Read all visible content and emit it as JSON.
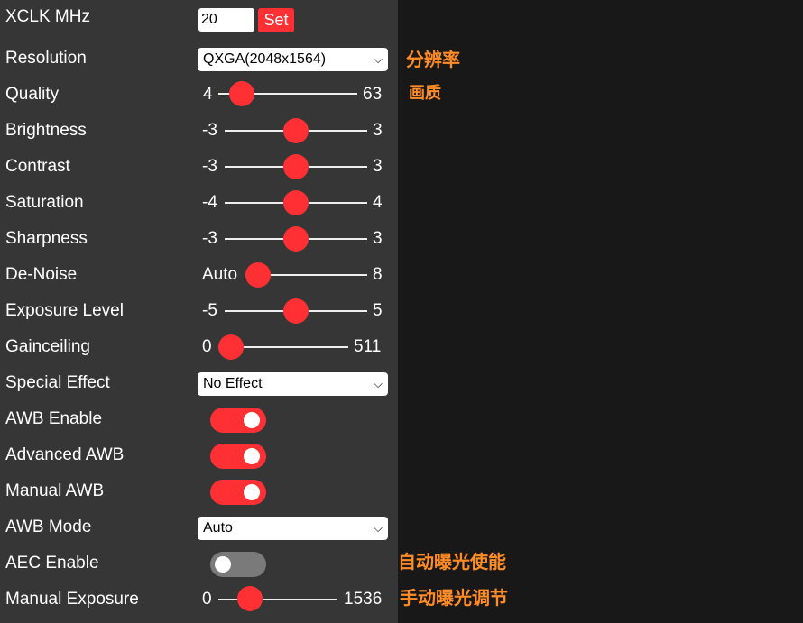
{
  "colors": {
    "panel_bg": "#363636",
    "page_bg": "#181818",
    "accent": "#ff3034",
    "toggle_off": "#7a7a7a",
    "annotation": "#ff8c26"
  },
  "xclk": {
    "label": "XCLK MHz",
    "value": "20",
    "button": "Set"
  },
  "resolution": {
    "label": "Resolution",
    "selected": "QXGA(2048x1564)",
    "note": "分辨率"
  },
  "quality": {
    "label": "Quality",
    "min": "4",
    "max": "63",
    "value": 10,
    "note": "画质"
  },
  "brightness": {
    "label": "Brightness",
    "min": "-3",
    "max": "3",
    "value": 0
  },
  "contrast": {
    "label": "Contrast",
    "min": "-3",
    "max": "3",
    "value": 0
  },
  "saturation": {
    "label": "Saturation",
    "min": "-4",
    "max": "4",
    "value": 0
  },
  "sharpness": {
    "label": "Sharpness",
    "min": "-3",
    "max": "3",
    "value": 0
  },
  "denoise": {
    "label": "De-Noise",
    "min": "Auto",
    "max": "8",
    "value": 0
  },
  "exposure_level": {
    "label": "Exposure Level",
    "min": "-5",
    "max": "5",
    "value": 0
  },
  "gainceiling": {
    "label": "Gainceiling",
    "min": "0",
    "max": "511",
    "value": 0
  },
  "special_effect": {
    "label": "Special Effect",
    "selected": "No Effect"
  },
  "awb_enable": {
    "label": "AWB Enable",
    "on": true
  },
  "advanced_awb": {
    "label": "Advanced AWB",
    "on": true
  },
  "manual_awb": {
    "label": "Manual AWB",
    "on": true
  },
  "awb_mode": {
    "label": "AWB Mode",
    "selected": "Auto"
  },
  "aec_enable": {
    "label": "AEC Enable",
    "on": false,
    "note": "自动曝光使能"
  },
  "manual_exposure": {
    "label": "Manual Exposure",
    "min": "0",
    "max": "1536",
    "value": 204,
    "note": "手动曝光调节"
  }
}
